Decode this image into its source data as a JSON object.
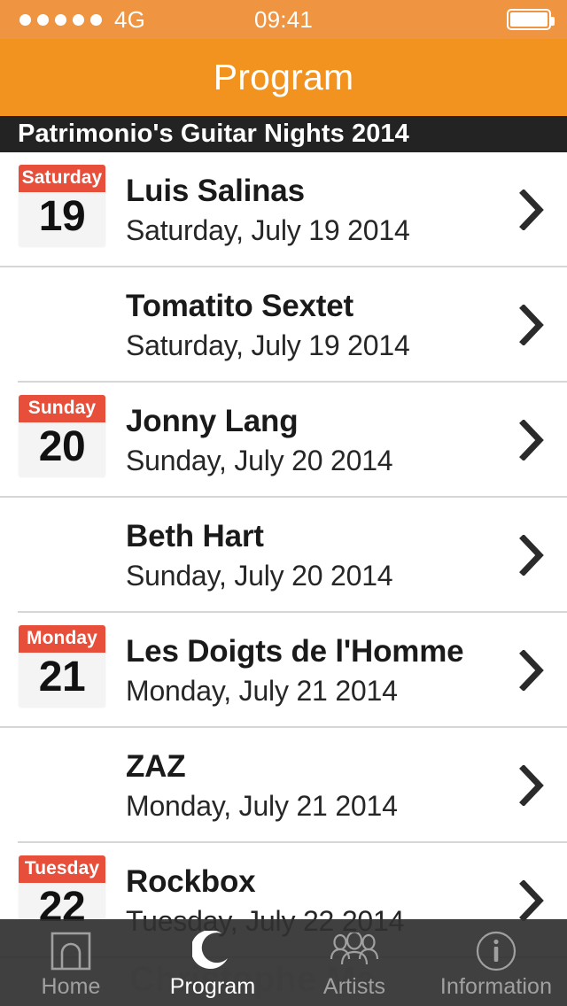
{
  "status_bar": {
    "signal_dots": 5,
    "carrier": "4G",
    "time": "09:41",
    "battery_icon": "battery-full-icon"
  },
  "nav": {
    "title": "Program"
  },
  "section": {
    "title": "Patrimonio's Guitar Nights 2014"
  },
  "colors": {
    "nav_orange": "#f3931f",
    "status_orange": "#ef9440",
    "section_dark": "#232323",
    "badge_red": "#e84f3b",
    "badge_body": "#f4f4f4",
    "tab_bar": "#303030",
    "tab_active": "#ffffff",
    "tab_inactive": "#a0a0a0",
    "separator": "#d6d6d6"
  },
  "events": [
    {
      "badge": {
        "day": "Saturday",
        "number": "19"
      },
      "title": "Luis Salinas",
      "subtitle": "Saturday, July 19 2014",
      "chevron": "chevron-right-icon"
    },
    {
      "badge": null,
      "title": "Tomatito Sextet",
      "subtitle": "Saturday, July 19 2014",
      "chevron": "chevron-right-icon"
    },
    {
      "badge": {
        "day": "Sunday",
        "number": "20"
      },
      "title": "Jonny Lang",
      "subtitle": "Sunday, July 20 2014",
      "chevron": "chevron-right-icon"
    },
    {
      "badge": null,
      "title": "Beth Hart",
      "subtitle": "Sunday, July 20 2014",
      "chevron": "chevron-right-icon"
    },
    {
      "badge": {
        "day": "Monday",
        "number": "21"
      },
      "title": "Les Doigts de l'Homme",
      "subtitle": "Monday, July 21 2014",
      "chevron": "chevron-right-icon"
    },
    {
      "badge": null,
      "title": "ZAZ",
      "subtitle": "Monday, July 21 2014",
      "chevron": "chevron-right-icon"
    },
    {
      "badge": {
        "day": "Tuesday",
        "number": "22"
      },
      "title": "Rockbox",
      "subtitle": "Tuesday, July 22 2014",
      "chevron": "chevron-right-icon"
    },
    {
      "badge": null,
      "title": "Christophe Ma",
      "subtitle": "",
      "chevron": "chevron-right-icon"
    }
  ],
  "tab_bar": {
    "tabs": [
      {
        "label": "Home",
        "icon": "home-arch-icon",
        "active": false
      },
      {
        "label": "Program",
        "icon": "moon-crescent-icon",
        "active": true
      },
      {
        "label": "Artists",
        "icon": "people-group-icon",
        "active": false
      },
      {
        "label": "Information",
        "icon": "info-circle-icon",
        "active": false
      }
    ]
  }
}
